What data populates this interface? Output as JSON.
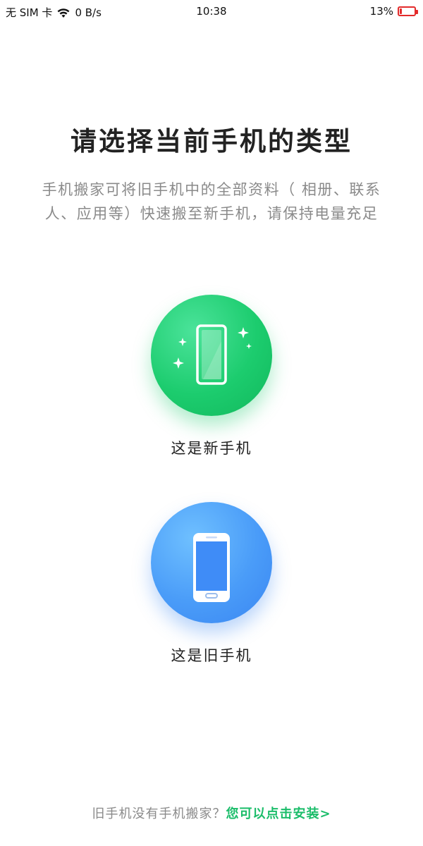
{
  "status_bar": {
    "sim": "无 SIM 卡",
    "speed": "0 B/s",
    "time": "10:38",
    "battery_text": "13%",
    "battery_level": 0.13,
    "battery_color": "#e32b2b"
  },
  "title": "请选择当前手机的类型",
  "description": "手机搬家可将旧手机中的全部资料（ 相册、联系人、应用等）快速搬至新手机，请保持电量充足",
  "options": [
    {
      "label": "这是新手机",
      "icon": "new-phone-icon",
      "color": "#1ccc6e"
    },
    {
      "label": "这是旧手机",
      "icon": "old-phone-icon",
      "color": "#3a86f2"
    }
  ],
  "footer": {
    "text": "旧手机没有手机搬家？",
    "link": "您可以点击安装>",
    "link_color": "#1bbd6a"
  }
}
